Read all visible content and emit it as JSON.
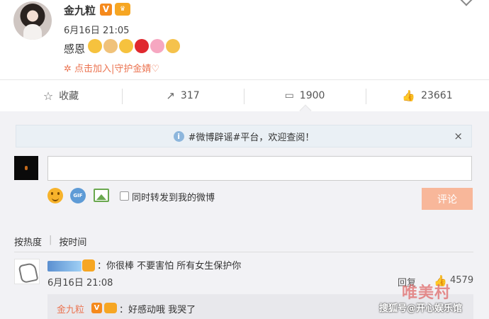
{
  "post": {
    "author": "金九粒",
    "badge_v": "V",
    "time": "6月16日 21:05",
    "text": "感恩",
    "emojis": [
      "#f6c23e",
      "#f0c27a",
      "#f6c23e",
      "#e0282e",
      "#f6a7c1",
      "#f5c24c"
    ],
    "topic_link": "✲ 点击加入|守护金婧♡"
  },
  "actions": {
    "favorite": "收藏",
    "forward": "317",
    "comment": "1900",
    "like": "23661"
  },
  "comments_panel": {
    "notice": "#微博辟谣#平台，欢迎查阅！",
    "notice_close": "×",
    "input_placeholder": "",
    "repost_label": "同时转发到我的微博",
    "submit": "评论",
    "sort_hot": "按热度",
    "sort_time": "按时间"
  },
  "comment": {
    "text": "：你很棒 不要害怕 所有女生保护你",
    "time": "6月16日 21:08",
    "reply": "回复",
    "likes": "4579",
    "reply_item": {
      "author": "金九粒",
      "badge_v": "V",
      "text": "：好感动哦 我哭了"
    }
  },
  "watermark": {
    "brand": "唯美村",
    "source": "搜狐号@开心娱乐馆"
  },
  "colors": {
    "accent": "#eb7350",
    "submit_bg": "#f8b79a",
    "panel_bg": "#f2f2f5",
    "notice_bg": "#eaf0f5"
  }
}
